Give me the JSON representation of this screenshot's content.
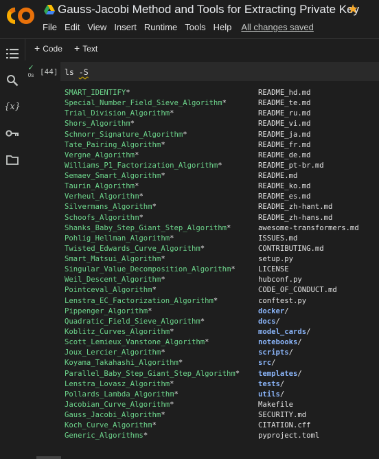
{
  "app": {
    "title": "Gauss-Jacobi Method and Tools for Extracting Private Key",
    "logo_text": "CO",
    "brand_colors": {
      "logo": "#f9ab00",
      "star": "#f9a825",
      "exe": "#6dd58c",
      "dir": "#8ab4f8"
    }
  },
  "menu": {
    "items": [
      "File",
      "Edit",
      "View",
      "Insert",
      "Runtime",
      "Tools",
      "Help"
    ],
    "save_status": "All changes saved"
  },
  "toolbar": {
    "code_label": "Code",
    "text_label": "Text"
  },
  "sidebar": {
    "icons": [
      "table-of-contents-icon",
      "search-icon",
      "variables-icon",
      "key-icon",
      "folder-icon"
    ],
    "variables_glyph": "{x}"
  },
  "cell": {
    "exec_count": "[44]",
    "run_time": "0s",
    "command": "ls",
    "argument": "-S",
    "output": {
      "left": [
        "SMART_IDENTIFY",
        "Special_Number_Field_Sieve_Algorithm",
        "Trial_Division_Algorithm",
        "Shors_Algorithm",
        "Schnorr_Signature_Algorithm",
        "Tate_Pairing_Algorithm",
        "Vergne_Algorithm",
        "Williams_P1_Factorization_Algorithm",
        "Semaev_Smart_Algorithm",
        "Taurin_Algorithm",
        "Verheul_Algorithm",
        "Silvermans_Algorithm",
        "Schoofs_Algorithm",
        "Shanks_Baby_Step_Giant_Step_Algorithm",
        "Pohlig_Hellman_Algorithm",
        "Twisted_Edwards_Curve_Algorithm",
        "Smart_Matsui_Algorithm",
        "Singular_Value_Decomposition_Algorithm",
        "Weil_Descent_Algorithm",
        "Pointceval_Algorithm",
        "Lenstra_EC_Factorization_Algorithm",
        "Pippenger_Algorithm",
        "Quadratic_Field_Sieve_Algorithm",
        "Koblitz_Curves_Algorithm",
        "Scott_Lemieux_Vanstone_Algorithm",
        "Joux_Lercier_Algorithm",
        "Koyama_Takahashi_Algorithm",
        "Parallel_Baby_Step_Giant_Step_Algorithm",
        "Lenstra_Lovasz_Algorithm",
        "Pollards_Lambda_Algorithm",
        "Jacobian_Curve_Algorithm",
        "Gauss_Jacobi_Algorithm",
        "Koch_Curve_Algorithm",
        "Generic_Algorithms"
      ],
      "right": [
        {
          "name": "README_hd.md",
          "dir": false
        },
        {
          "name": "README_te.md",
          "dir": false
        },
        {
          "name": "README_ru.md",
          "dir": false
        },
        {
          "name": "README_vi.md",
          "dir": false
        },
        {
          "name": "README_ja.md",
          "dir": false
        },
        {
          "name": "README_fr.md",
          "dir": false
        },
        {
          "name": "README_de.md",
          "dir": false
        },
        {
          "name": "README_pt-br.md",
          "dir": false
        },
        {
          "name": "README.md",
          "dir": false
        },
        {
          "name": "README_ko.md",
          "dir": false
        },
        {
          "name": "README_es.md",
          "dir": false
        },
        {
          "name": "README_zh-hant.md",
          "dir": false
        },
        {
          "name": "README_zh-hans.md",
          "dir": false
        },
        {
          "name": "awesome-transformers.md",
          "dir": false
        },
        {
          "name": "ISSUES.md",
          "dir": false
        },
        {
          "name": "CONTRIBUTING.md",
          "dir": false
        },
        {
          "name": "setup.py",
          "dir": false
        },
        {
          "name": "LICENSE",
          "dir": false
        },
        {
          "name": "hubconf.py",
          "dir": false
        },
        {
          "name": "CODE_OF_CONDUCT.md",
          "dir": false
        },
        {
          "name": "conftest.py",
          "dir": false
        },
        {
          "name": "docker",
          "dir": true
        },
        {
          "name": "docs",
          "dir": true
        },
        {
          "name": "model_cards",
          "dir": true
        },
        {
          "name": "notebooks",
          "dir": true
        },
        {
          "name": "scripts",
          "dir": true
        },
        {
          "name": "src",
          "dir": true
        },
        {
          "name": "templates",
          "dir": true
        },
        {
          "name": "tests",
          "dir": true
        },
        {
          "name": "utils",
          "dir": true
        },
        {
          "name": "Makefile",
          "dir": false
        },
        {
          "name": "SECURITY.md",
          "dir": false
        },
        {
          "name": "CITATION.cff",
          "dir": false
        },
        {
          "name": "pyproject.toml",
          "dir": false
        }
      ]
    }
  }
}
